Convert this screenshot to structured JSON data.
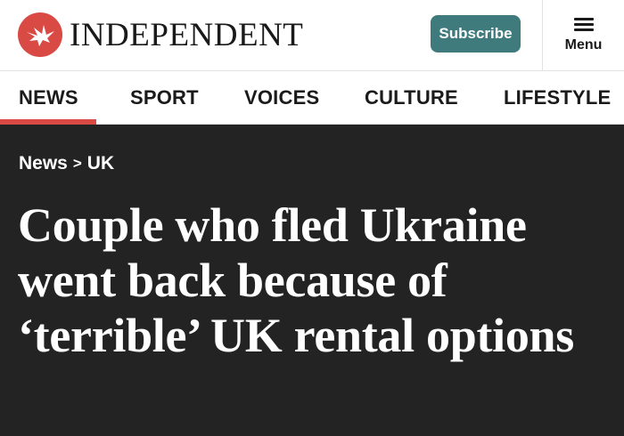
{
  "header": {
    "logo_text": "INDEPENDENT",
    "subscribe_label": "Subscribe",
    "menu_label": "Menu"
  },
  "nav": {
    "items": [
      {
        "label": "NEWS",
        "active": true
      },
      {
        "label": "SPORT",
        "active": false
      },
      {
        "label": "VOICES",
        "active": false
      },
      {
        "label": "CULTURE",
        "active": false
      },
      {
        "label": "LIFESTYLE",
        "active": false
      }
    ]
  },
  "breadcrumb": {
    "section": "News",
    "separator": ">",
    "subsection": "UK"
  },
  "article": {
    "headline": "Couple who fled Ukraine went back because of ‘terrible’ UK rental options"
  },
  "colors": {
    "brand_red": "#d94a45",
    "subscribe_teal": "#3f7b7d",
    "hero_background": "#232323"
  },
  "icons": {
    "logo": "eagle-icon",
    "menu": "hamburger-icon"
  }
}
